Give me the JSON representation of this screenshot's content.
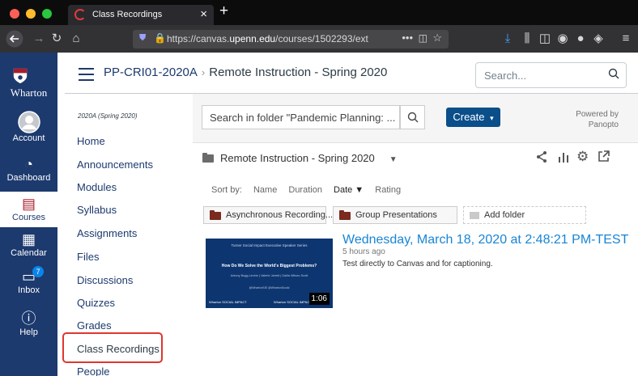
{
  "browser": {
    "tab_title": "Class Recordings",
    "tab_close": "×",
    "new_tab": "+",
    "url_prefix": "https://canvas.",
    "url_domain": "upenn.edu",
    "url_path": "/courses/1502293/ext",
    "url_more": "•••"
  },
  "global_nav": {
    "logo_text": "Wharton",
    "items": [
      {
        "label": "Account"
      },
      {
        "label": "Dashboard"
      },
      {
        "label": "Courses"
      },
      {
        "label": "Calendar"
      },
      {
        "label": "Inbox",
        "badge": "7"
      },
      {
        "label": "Help"
      }
    ]
  },
  "header": {
    "course": "PP-CRI01-2020A",
    "separator": "›",
    "page": "Remote Instruction - Spring 2020",
    "search_placeholder": "Search..."
  },
  "course_nav": {
    "term": "2020A (Spring 2020)",
    "items": [
      "Home",
      "Announcements",
      "Modules",
      "Syllabus",
      "Assignments",
      "Files",
      "Discussions",
      "Quizzes",
      "Grades",
      "Class Recordings",
      "People"
    ],
    "selected": "Class Recordings"
  },
  "panopto": {
    "folder_search": "Search in folder \"Pandemic Planning: ...",
    "create_label": "Create",
    "create_caret": "▾",
    "powered_line1": "Powered by",
    "powered_line2": "Panopto",
    "folder_name": "Remote Instruction - Spring 2020",
    "sort": {
      "label": "Sort by:",
      "options": [
        "Name",
        "Duration",
        "Date ▼",
        "Rating"
      ],
      "active": "Date"
    },
    "subfolders": [
      "Asynchronous Recording...",
      "Group Presentations"
    ],
    "add_folder": "Add folder",
    "session": {
      "thumb_series": "Turner Social Impact Executive Speaker Series",
      "thumb_title": "How Do We Solve the World's Biggest Problems?",
      "thumb_speakers": "Antony Bugg-Levine | Valerie Jarrett | Dalila Wilson-Scott",
      "thumb_handles": "@WhartonSIE  @WhartonSocial",
      "thumb_logo1": "Wharton  SOCIAL IMPACT",
      "thumb_logo2": "Wharton  SOCIAL IMPACT",
      "duration": "1:06",
      "title": "Wednesday, March 18, 2020 at 2:48:21 PM-TEST",
      "ago": "5 hours ago",
      "description": "Test directly to Canvas and for captioning."
    }
  },
  "colors": {
    "canvas_nav": "#1c3a6e",
    "create_button": "#0a4e8a",
    "session_link": "#1785d6",
    "highlight": "#e0352f"
  }
}
